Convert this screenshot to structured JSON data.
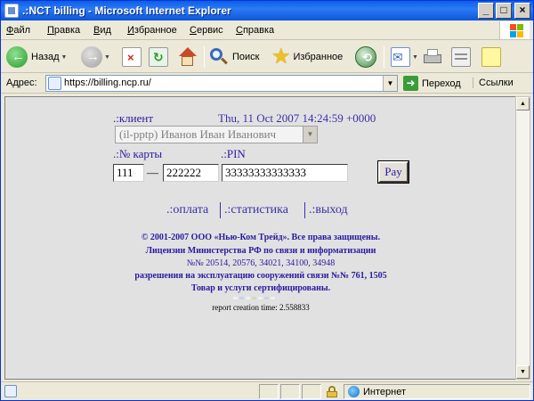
{
  "window": {
    "title": ".:NCT billing - Microsoft Internet Explorer"
  },
  "menu": [
    "Файл",
    "Правка",
    "Вид",
    "Избранное",
    "Сервис",
    "Справка"
  ],
  "toolbar": {
    "back": "Назад",
    "search": "Поиск",
    "favorites": "Избранное"
  },
  "address": {
    "label": "Адрес:",
    "url": "https://billing.ncp.ru/",
    "go": "Переход",
    "links": "Ссылки"
  },
  "page": {
    "client_label": ".:клиент",
    "datetime": "Thu, 11 Oct 2007 14:24:59 +0000",
    "client_select": "(il-pptp) Иванов Иван Иванович",
    "card_label": ".:№ карты",
    "pin_label": ".:PIN",
    "card_part1": "111",
    "dash": "—",
    "card_part2": "222222",
    "pin_value": "33333333333333",
    "pay_button": "Pay",
    "nav": {
      "payment": ".:оплата",
      "stats": ".:статистика",
      "exit": ".:выход"
    },
    "footer": {
      "line1": "© 2001-2007 ООО «Нью-Ком Трейд». Все права защищены.",
      "line2": "Лицензии Министерства РФ по связи и информатизации",
      "line3": "№№ 20514, 20576, 34021, 34100, 34948",
      "line4": "разрешения на эксплуатацию сооружений связи №№ 761, 1505",
      "line5": "Товар и услуги сертифицированы."
    },
    "report": "report creation time: 2.558833"
  },
  "status": {
    "zone": "Интернет"
  }
}
